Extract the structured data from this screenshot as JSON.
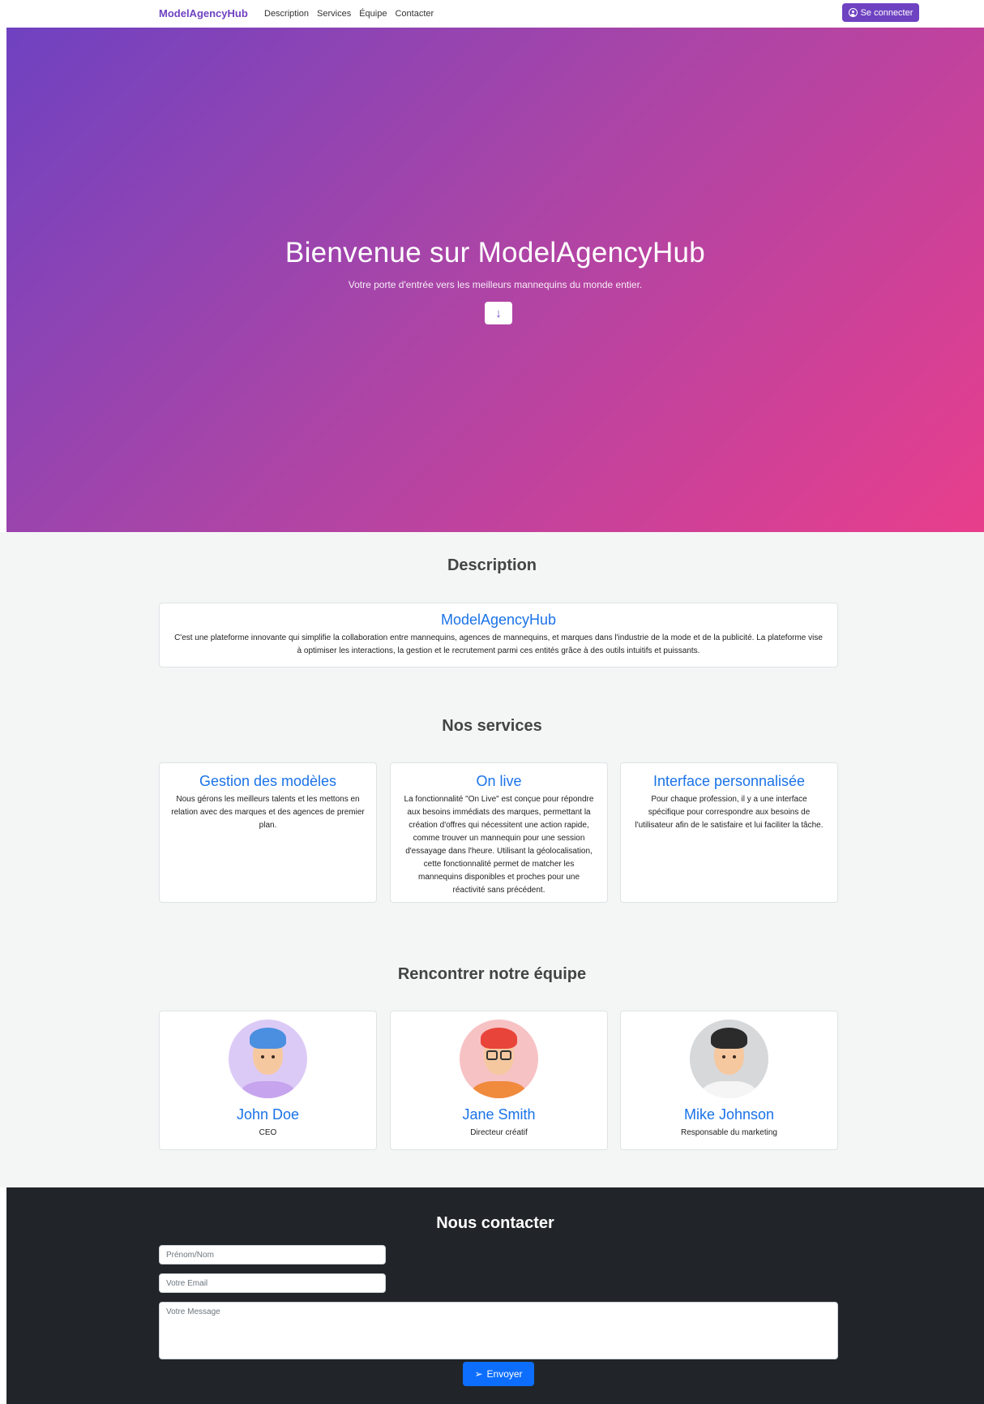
{
  "navbar": {
    "brand": "ModelAgencyHub",
    "links": [
      "Description",
      "Services",
      "Équipe",
      "Contacter"
    ],
    "login_label": "Se connecter"
  },
  "hero": {
    "title": "Bienvenue sur ModelAgencyHub",
    "subtitle": "Votre porte d'entrée vers les meilleurs mannequins du monde entier.",
    "scroll_icon": "↓"
  },
  "description": {
    "section_title": "Description",
    "card_title": "ModelAgencyHub",
    "card_text": "C'est une plateforme innovante qui simplifie la collaboration entre mannequins, agences de mannequins, et marques dans l'industrie de la mode et de la publicité. La plateforme vise à optimiser les interactions, la gestion et le recrutement parmi ces entités grâce à des outils intuitifs et puissants."
  },
  "services": {
    "section_title": "Nos services",
    "items": [
      {
        "title": "Gestion des modèles",
        "text": "Nous gérons les meilleurs talents et les mettons en relation avec des marques et des agences de premier plan."
      },
      {
        "title": "On live",
        "text": "La fonctionnalité \"On Live\" est conçue pour répondre aux besoins immédiats des marques, permettant la création d'offres qui nécessitent une action rapide, comme trouver un mannequin pour une session d'essayage dans l'heure. Utilisant la géolocalisation, cette fonctionnalité permet de matcher les mannequins disponibles et proches pour une réactivité sans précédent."
      },
      {
        "title": "Interface personnalisée",
        "text": "Pour chaque profession, il y a une interface spécifique pour correspondre aux besoins de l'utilisateur afin de le satisfaire et lui faciliter la tâche."
      }
    ]
  },
  "team": {
    "section_title": "Rencontrer notre équipe",
    "members": [
      {
        "name": "John Doe",
        "role": "CEO"
      },
      {
        "name": "Jane Smith",
        "role": "Directeur créatif"
      },
      {
        "name": "Mike Johnson",
        "role": "Responsable du marketing"
      }
    ]
  },
  "contact": {
    "section_title": "Nous contacter",
    "name_placeholder": "Prénom/Nom",
    "email_placeholder": "Votre Email",
    "message_placeholder": "Votre Message",
    "send_label": "Envoyer"
  },
  "colors": {
    "brand": "#6f42c1",
    "accent": "#e83e8c",
    "link_blue": "#1a73e8",
    "button_blue": "#0d6efd",
    "dark_bg": "#212529"
  }
}
